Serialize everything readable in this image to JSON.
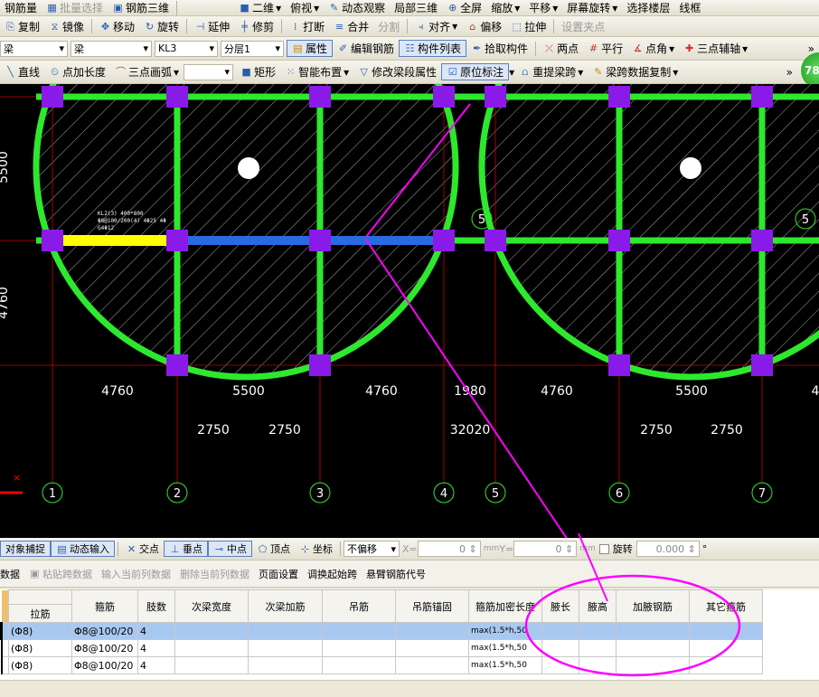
{
  "toolbar1": [
    "钢筋量",
    "批量选择",
    "钢筋三维",
    "二维",
    "俯视",
    "动态观察",
    "局部三维",
    "全屏",
    "缩放",
    "平移",
    "屏幕旋转",
    "选择楼层",
    "线框"
  ],
  "toolbar2": [
    "复制",
    "镜像",
    "移动",
    "旋转",
    "延伸",
    "修剪",
    "打断",
    "合并",
    "分割",
    "对齐",
    "偏移",
    "拉伸",
    "设置夹点"
  ],
  "toolbar3": {
    "combos": [
      "梁",
      "梁",
      "KL3",
      "分层1"
    ],
    "buttons": [
      "属性",
      "编辑钢筋",
      "构件列表",
      "拾取构件",
      "两点",
      "平行",
      "点角",
      "三点辅轴"
    ]
  },
  "toolbar4": [
    "直线",
    "点加长度",
    "三点画弧",
    "矩形",
    "智能布置",
    "修改梁段属性",
    "原位标注",
    "重提梁跨",
    "梁跨数据复制"
  ],
  "badge": "78",
  "canvas": {
    "left_dims": [
      "5500",
      "4760"
    ],
    "dims_row1": [
      "4760",
      "5500",
      "4760",
      "1980",
      "4760",
      "5500",
      "4"
    ],
    "dims_row2": [
      "2750",
      "2750",
      "32020",
      "2750",
      "2750"
    ],
    "axes": [
      "1",
      "2",
      "3",
      "4",
      "5",
      "6",
      "7"
    ],
    "side_axes": [
      "5",
      "5"
    ],
    "beam_label": [
      "KL2(3) 400*800",
      "Φ8@100/200(4) 4Φ25 4Φ",
      "G4Φ12"
    ]
  },
  "snap": {
    "items": [
      "对象捕捉",
      "动态输入",
      "交点",
      "垂点",
      "中点",
      "顶点",
      "坐标"
    ],
    "offset": "不偏移",
    "x_label": "X=",
    "x": "0",
    "y_label": "Y=",
    "y": "0",
    "unit": "mm",
    "rotate": "旋转",
    "angle": "0.000"
  },
  "actions": [
    "数据",
    "粘贴跨数据",
    "输入当前列数据",
    "删除当前列数据",
    "页面设置",
    "调换起始跨",
    "悬臂钢筋代号"
  ],
  "table": {
    "headers": [
      "拉筋",
      "箍筋",
      "肢数",
      "次梁宽度",
      "次梁加筋",
      "吊筋",
      "吊筋锚固",
      "箍筋加密长度",
      "腋长",
      "腋高",
      "加腋钢筋",
      "其它箍筋"
    ],
    "rows": [
      [
        "(Φ8)",
        "Φ8@100/20",
        "4",
        "",
        "",
        "",
        "",
        "max(1.5*h,50",
        "",
        "",
        "",
        ""
      ],
      [
        "(Φ8)",
        "Φ8@100/20",
        "4",
        "",
        "",
        "",
        "",
        "max(1.5*h,50",
        "",
        "",
        "",
        ""
      ],
      [
        "(Φ8)",
        "Φ8@100/20",
        "4",
        "",
        "",
        "",
        "",
        "max(1.5*h,50",
        "",
        "",
        "",
        ""
      ]
    ]
  }
}
